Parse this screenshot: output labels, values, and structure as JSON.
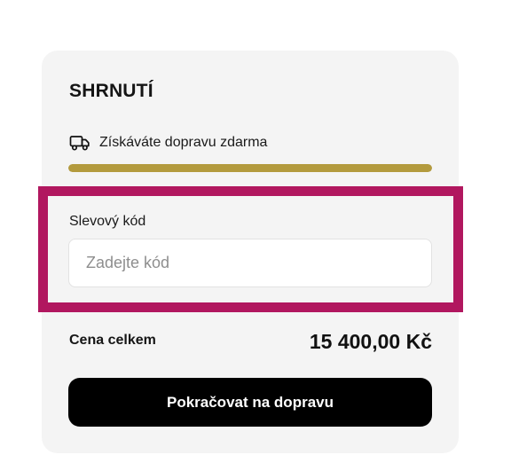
{
  "summary": {
    "title": "SHRNUTÍ",
    "shipping": {
      "icon": "truck-icon",
      "text": "Získáváte dopravu zdarma",
      "progress_fraction": 1.0,
      "progress_color": "#b39a3d"
    },
    "discount": {
      "label": "Slevový kód",
      "value": "",
      "placeholder": "Zadejte kód"
    },
    "total": {
      "label": "Cena celkem",
      "value": "15 400,00 Kč"
    },
    "continue_button": {
      "label": "Pokračovat na dopravu"
    },
    "highlight_color": "#b1175f"
  }
}
